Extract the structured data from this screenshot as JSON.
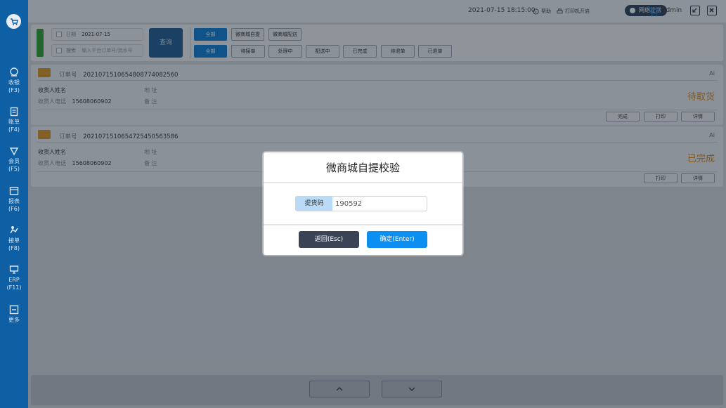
{
  "colors": {
    "sidebar": "#0e5fa3",
    "primary": "#0c8ff0",
    "status": "#d98b1a",
    "online": "#2f9e2f"
  },
  "sidebar": {
    "items": [
      {
        "label": "收银",
        "key": "(F3)",
        "icon": "cashier-icon"
      },
      {
        "label": "账单",
        "key": "(F4)",
        "icon": "bill-icon"
      },
      {
        "label": "会员",
        "key": "(F5)",
        "icon": "member-icon"
      },
      {
        "label": "报表",
        "key": "(F6)",
        "icon": "report-icon"
      },
      {
        "label": "接单",
        "key": "(F8)",
        "icon": "order-icon"
      },
      {
        "label": "ERP",
        "key": "(F11)",
        "icon": "erp-icon"
      },
      {
        "label": "更多",
        "key": "",
        "icon": "more-icon"
      }
    ]
  },
  "topbar": {
    "datetime": "2021-07-15 18:15:00",
    "help": "帮助",
    "printer": "打印机开启",
    "network": "网络正常",
    "user": "admin"
  },
  "filter": {
    "date_label": "日期",
    "date_value": "2021-07-15",
    "search_label": "搜索",
    "search_placeholder": "输入平台订单号/流水号",
    "query": "查询",
    "row1": [
      "全部",
      "微商城自提",
      "微商城配送"
    ],
    "row2": [
      "全部",
      "待接单",
      "处理中",
      "配送中",
      "已完成",
      "待退单",
      "已退单"
    ]
  },
  "orders": [
    {
      "order_label": "订单号",
      "order_no": "20210715106548087740825​60",
      "receiver_name_label": "收货人姓名",
      "receiver_phone_label": "收货人电话",
      "phone": "15608060902",
      "address_label": "地 址",
      "remark_label": "备 注",
      "status": "待取货",
      "right_tag": "Ai",
      "buttons": [
        "完成",
        "打印",
        "详情"
      ]
    },
    {
      "order_label": "订单号",
      "order_no": "20210715106547254505635​86",
      "receiver_name_label": "收货人姓名",
      "receiver_phone_label": "收货人电话",
      "phone": "15608060902",
      "address_label": "地 址",
      "remark_label": "备 注",
      "status": "已完成",
      "right_tag": "Ai",
      "buttons": [
        "打印",
        "详情"
      ]
    }
  ],
  "modal": {
    "title": "微商城自提校验",
    "code_label": "提货码",
    "code_value": "190592",
    "back": "返回(Esc)",
    "confirm": "确定(Enter)"
  },
  "pager": {
    "up_icon": "chevron-up-icon",
    "down_icon": "chevron-down-icon"
  }
}
